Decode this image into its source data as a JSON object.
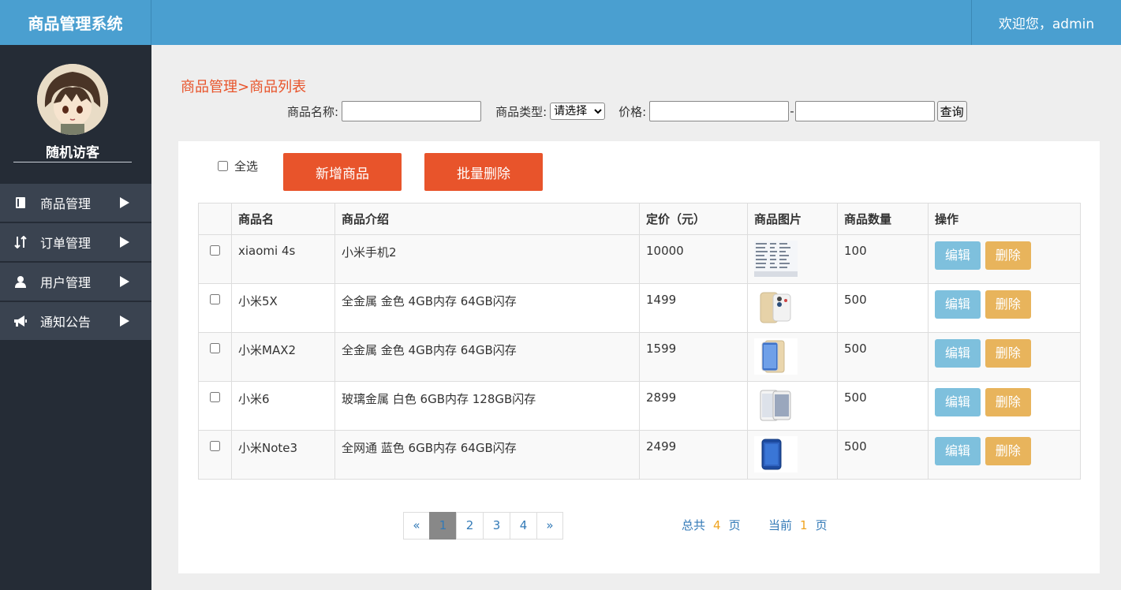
{
  "header": {
    "brand": "商品管理系统",
    "welcome": "欢迎您，admin"
  },
  "sidebar": {
    "username": "随机访客",
    "items": [
      {
        "label": "商品管理",
        "icon": "book-icon"
      },
      {
        "label": "订单管理",
        "icon": "sort-arrows-icon"
      },
      {
        "label": "用户管理",
        "icon": "user-icon"
      },
      {
        "label": "通知公告",
        "icon": "bullhorn-icon"
      }
    ]
  },
  "breadcrumb": "商品管理>商品列表",
  "filter": {
    "name_label": "商品名称:",
    "type_label": "商品类型:",
    "type_selected": "请选择",
    "price_label": "价格:",
    "price_sep": "-",
    "query_label": "查询"
  },
  "toolbar": {
    "select_all": "全选",
    "add": "新增商品",
    "batch_delete": "批量删除"
  },
  "table": {
    "headers": [
      "商品名",
      "商品介绍",
      "定价（元）",
      "商品图片",
      "商品数量",
      "操作"
    ],
    "rows": [
      {
        "name": "xiaomi 4s",
        "desc": "小米手机2",
        "price": "10000",
        "image": "screenshot-thumbnail",
        "qty": "100"
      },
      {
        "name": "小米5X",
        "desc": "全金属 金色 4GB内存 64GB闪存",
        "price": "1499",
        "image": "gold-phone-thumbnail",
        "qty": "500"
      },
      {
        "name": "小米MAX2",
        "desc": "全金属 金色 4GB内存 64GB闪存",
        "price": "1599",
        "image": "gold-phone-thumbnail",
        "qty": "500"
      },
      {
        "name": "小米6",
        "desc": "玻璃金属 白色 6GB内存 128GB闪存",
        "price": "2899",
        "image": "white-phone-thumbnail",
        "qty": "500"
      },
      {
        "name": "小米Note3",
        "desc": "全网通 蓝色 6GB内存 64GB闪存",
        "price": "2499",
        "image": "blue-phone-thumbnail",
        "qty": "500"
      }
    ],
    "edit_label": "编辑",
    "delete_label": "删除"
  },
  "pagination": {
    "prev": "«",
    "pages": [
      "1",
      "2",
      "3",
      "4"
    ],
    "next": "»",
    "current": 1,
    "total_prefix": "总共",
    "total": "4",
    "page_unit": "页",
    "current_prefix": "当前",
    "current_text": "1"
  },
  "colors": {
    "header": "#4a9fd0",
    "sidebar": "#252c36",
    "accent": "#e8542b",
    "edit": "#7ec0dd",
    "delete": "#e8b45c"
  }
}
